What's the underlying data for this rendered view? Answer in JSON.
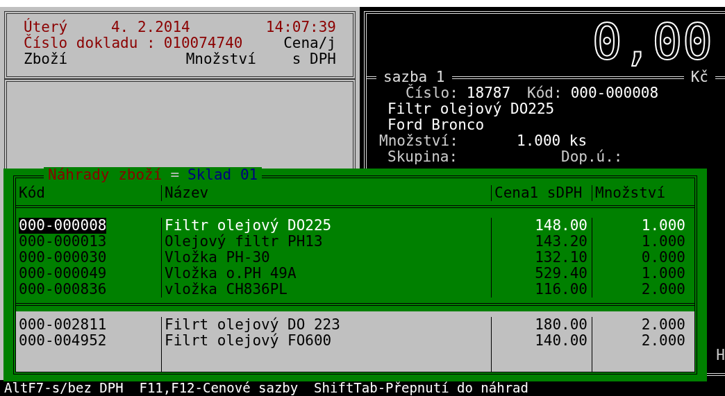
{
  "receipt": {
    "day": "Úterý",
    "date": "4. 2.2014",
    "time": "14:07:39",
    "document_label": "Číslo dokladu :",
    "document_number": "010074740",
    "columns": {
      "item": "Zboží",
      "quantity": "Množství",
      "price_line1": "Cena/j",
      "price_line2": "s DPH"
    }
  },
  "display": {
    "total": "0,00",
    "rate_label": "sazba 1",
    "currency": "Kč",
    "number_label": "Číslo:",
    "number": "18787",
    "code_label": "Kód:",
    "code": "000-000008",
    "name": "Filtr olejový DO225",
    "note": "Ford Bronco",
    "quantity_label": "Množství:",
    "quantity": "1.000 ks",
    "group_label": "Skupina:",
    "extra_label": "Dop.ú.:",
    "edge_text": "H"
  },
  "dialog": {
    "title": "Náhrady zboží",
    "separator": "=",
    "store": "Sklad 01",
    "columns": [
      "Kód",
      "Název",
      "Cena1 sDPH",
      "Množství"
    ],
    "rows": [
      {
        "code": "000-000008",
        "name": "Filtr olejový DO225",
        "price": "148.00",
        "quantity": "1.000",
        "selected": true
      },
      {
        "code": "000-000013",
        "name": "Olejový filtr PH13",
        "price": "143.20",
        "quantity": "1.000",
        "selected": false
      },
      {
        "code": "000-000030",
        "name": "Vložka PH-30",
        "price": "132.10",
        "quantity": "0.000",
        "selected": false
      },
      {
        "code": "000-000049",
        "name": "Vložka o.PH 49A",
        "price": "529.40",
        "quantity": "1.000",
        "selected": false
      },
      {
        "code": "000-000836",
        "name": "vložka CH836PL",
        "price": "116.00",
        "quantity": "2.000",
        "selected": false
      }
    ],
    "other_rows": [
      {
        "code": "000-002811",
        "name": "Filrt olejový DO 223",
        "price": "180.00",
        "quantity": "2.000"
      },
      {
        "code": "000-004952",
        "name": "Filrt olejový FO600",
        "price": "140.00",
        "quantity": "2.000"
      }
    ]
  },
  "status_bar": "AltF7-s/bez DPH  F11,F12-Cenové sazby  ShiftTab-Přepnutí do náhrad"
}
